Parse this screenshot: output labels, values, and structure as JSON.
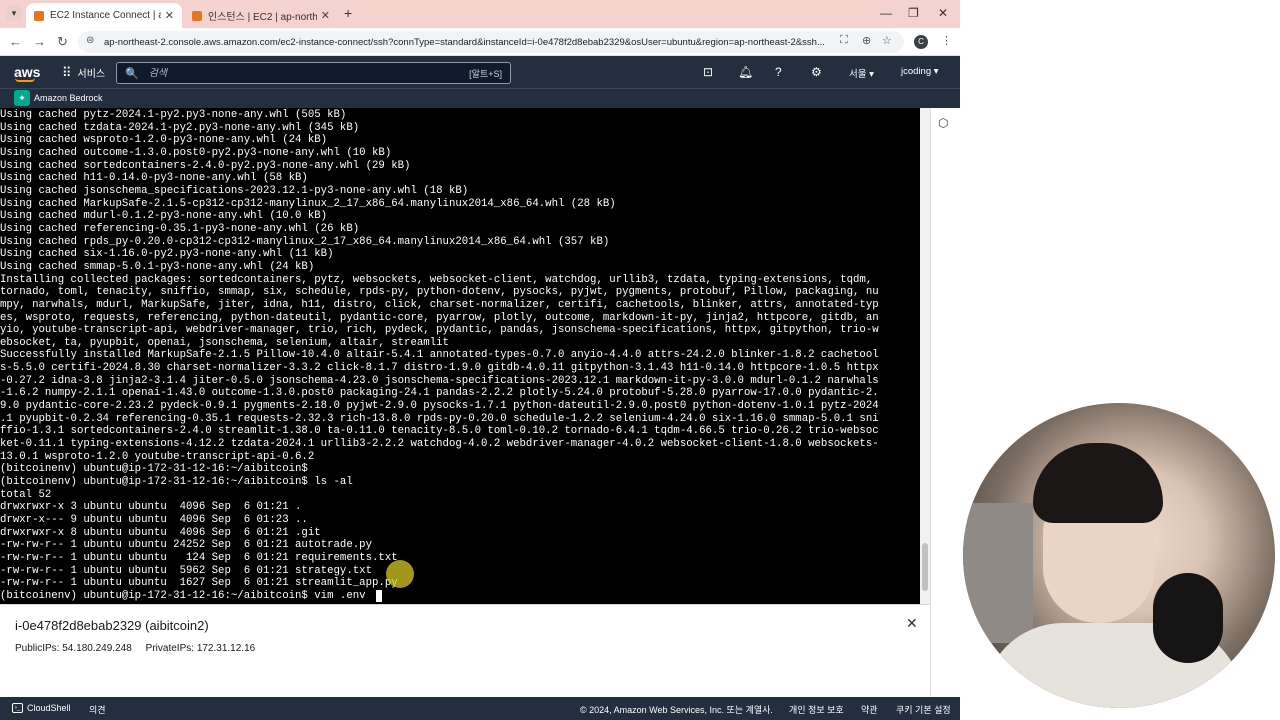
{
  "browser": {
    "tabs": [
      {
        "label": "EC2 Instance Connect | ap-no",
        "active": true
      },
      {
        "label": "인스턴스 | EC2 | ap-northeast",
        "active": false
      }
    ],
    "new_tab": "+",
    "url": "ap-northeast-2.console.aws.amazon.com/ec2-instance-connect/ssh?connType=standard&instanceId=i-0e478f2d8ebab2329&osUser=ubuntu&region=ap-northeast-2&ssh...",
    "profile_initial": "C"
  },
  "aws_header": {
    "logo": "aws",
    "services_label": "서비스",
    "search_placeholder": "검색",
    "search_shortcut": "[알트+S]",
    "region": "서울 ▾",
    "account": "jcoding ▾",
    "favorite": "Amazon Bedrock"
  },
  "terminal": {
    "lines": [
      "Using cached pytz-2024.1-py2.py3-none-any.whl (505 kB)",
      "Using cached tzdata-2024.1-py2.py3-none-any.whl (345 kB)",
      "Using cached wsproto-1.2.0-py3-none-any.whl (24 kB)",
      "Using cached outcome-1.3.0.post0-py2.py3-none-any.whl (10 kB)",
      "Using cached sortedcontainers-2.4.0-py2.py3-none-any.whl (29 kB)",
      "Using cached h11-0.14.0-py3-none-any.whl (58 kB)",
      "Using cached jsonschema_specifications-2023.12.1-py3-none-any.whl (18 kB)",
      "Using cached MarkupSafe-2.1.5-cp312-cp312-manylinux_2_17_x86_64.manylinux2014_x86_64.whl (28 kB)",
      "Using cached mdurl-0.1.2-py3-none-any.whl (10.0 kB)",
      "Using cached referencing-0.35.1-py3-none-any.whl (26 kB)",
      "Using cached rpds_py-0.20.0-cp312-cp312-manylinux_2_17_x86_64.manylinux2014_x86_64.whl (357 kB)",
      "Using cached six-1.16.0-py2.py3-none-any.whl (11 kB)",
      "Using cached smmap-5.0.1-py3-none-any.whl (24 kB)",
      "Installing collected packages: sortedcontainers, pytz, websockets, websocket-client, watchdog, urllib3, tzdata, typing-extensions, tqdm,",
      "tornado, toml, tenacity, sniffio, smmap, six, schedule, rpds-py, python-dotenv, pysocks, pyjwt, pygments, protobuf, Pillow, packaging, nu",
      "mpy, narwhals, mdurl, MarkupSafe, jiter, idna, h11, distro, click, charset-normalizer, certifi, cachetools, blinker, attrs, annotated-typ",
      "es, wsproto, requests, referencing, python-dateutil, pydantic-core, pyarrow, plotly, outcome, markdown-it-py, jinja2, httpcore, gitdb, an",
      "yio, youtube-transcript-api, webdriver-manager, trio, rich, pydeck, pydantic, pandas, jsonschema-specifications, httpx, gitpython, trio-w",
      "ebsocket, ta, pyupbit, openai, jsonschema, selenium, altair, streamlit",
      "Successfully installed MarkupSafe-2.1.5 Pillow-10.4.0 altair-5.4.1 annotated-types-0.7.0 anyio-4.4.0 attrs-24.2.0 blinker-1.8.2 cachetool",
      "s-5.5.0 certifi-2024.8.30 charset-normalizer-3.3.2 click-8.1.7 distro-1.9.0 gitdb-4.0.11 gitpython-3.1.43 h11-0.14.0 httpcore-1.0.5 httpx",
      "-0.27.2 idna-3.8 jinja2-3.1.4 jiter-0.5.0 jsonschema-4.23.0 jsonschema-specifications-2023.12.1 markdown-it-py-3.0.0 mdurl-0.1.2 narwhals",
      "-1.6.2 numpy-2.1.1 openai-1.43.0 outcome-1.3.0.post0 packaging-24.1 pandas-2.2.2 plotly-5.24.0 protobuf-5.28.0 pyarrow-17.0.0 pydantic-2.",
      "9.0 pydantic-core-2.23.2 pydeck-0.9.1 pygments-2.18.0 pyjwt-2.9.0 pysocks-1.7.1 python-dateutil-2.9.0.post0 python-dotenv-1.0.1 pytz-2024",
      ".1 pyupbit-0.2.34 referencing-0.35.1 requests-2.32.3 rich-13.8.0 rpds-py-0.20.0 schedule-1.2.2 selenium-4.24.0 six-1.16.0 smmap-5.0.1 sni",
      "ffio-1.3.1 sortedcontainers-2.4.0 streamlit-1.38.0 ta-0.11.0 tenacity-8.5.0 toml-0.10.2 tornado-6.4.1 tqdm-4.66.5 trio-0.26.2 trio-websoc",
      "ket-0.11.1 typing-extensions-4.12.2 tzdata-2024.1 urllib3-2.2.2 watchdog-4.0.2 webdriver-manager-4.0.2 websocket-client-1.8.0 websockets-",
      "13.0.1 wsproto-1.2.0 youtube-transcript-api-0.6.2",
      "(bitcoinenv) ubuntu@ip-172-31-12-16:~/aibitcoin$",
      "(bitcoinenv) ubuntu@ip-172-31-12-16:~/aibitcoin$ ls -al",
      "total 52",
      "drwxrwxr-x 3 ubuntu ubuntu  4096 Sep  6 01:21 .",
      "drwxr-x--- 9 ubuntu ubuntu  4096 Sep  6 01:23 ..",
      "drwxrwxr-x 8 ubuntu ubuntu  4096 Sep  6 01:21 .git",
      "-rw-rw-r-- 1 ubuntu ubuntu 24252 Sep  6 01:21 autotrade.py",
      "-rw-rw-r-- 1 ubuntu ubuntu   124 Sep  6 01:21 requirements.txt",
      "-rw-rw-r-- 1 ubuntu ubuntu  5962 Sep  6 01:21 strategy.txt",
      "-rw-rw-r-- 1 ubuntu ubuntu  1627 Sep  6 01:21 streamlit_app.py",
      "(bitcoinenv) ubuntu@ip-172-31-12-16:~/aibitcoin$ vim .env"
    ]
  },
  "instance": {
    "title": "i-0e478f2d8ebab2329 (aibitcoin2)",
    "public_ips_label": "PublicIPs:",
    "public_ips": "54.180.249.248",
    "private_ips_label": "PrivateIPs:",
    "private_ips": "172.31.12.16"
  },
  "footer": {
    "cloudshell": "CloudShell",
    "feedback": "의견",
    "copyright": "© 2024, Amazon Web Services, Inc. 또는 계열사.",
    "privacy": "개인 정보 보호",
    "terms": "약관",
    "cookies": "쿠키 기본 설정"
  }
}
